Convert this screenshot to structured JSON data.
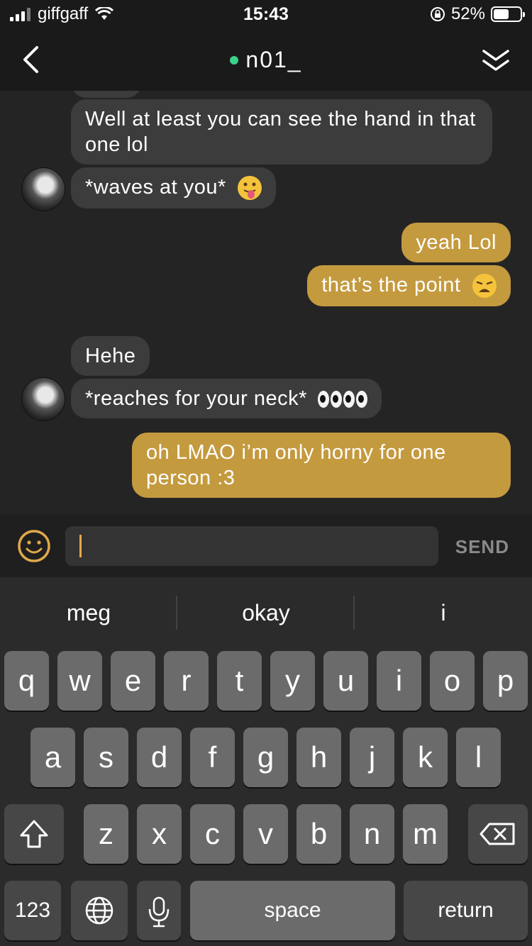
{
  "status": {
    "carrier": "giffgaff",
    "time": "15:43",
    "battery": "52%"
  },
  "header": {
    "contact_name": "n01_"
  },
  "messages": [
    {
      "dir": "in",
      "text": "Well at least you can see the hand in that one lol"
    },
    {
      "dir": "in",
      "text": "*waves at you*",
      "emoji": "tongue-out-emoji"
    },
    {
      "dir": "out",
      "text": "yeah Lol"
    },
    {
      "dir": "out",
      "text": "that’s the point",
      "emoji": "weary-face-emoji"
    },
    {
      "dir": "in",
      "text": "Hehe"
    },
    {
      "dir": "in",
      "text": "*reaches for your neck*",
      "emoji": "eyes-emoji"
    },
    {
      "dir": "out",
      "text": "oh LMAO i’m only horny  for one person :3"
    }
  ],
  "input": {
    "value": "",
    "send_label": "SEND"
  },
  "keyboard": {
    "suggestions": [
      "meg",
      "okay",
      "i"
    ],
    "row1": [
      "q",
      "w",
      "e",
      "r",
      "t",
      "y",
      "u",
      "i",
      "o",
      "p"
    ],
    "row2": [
      "a",
      "s",
      "d",
      "f",
      "g",
      "h",
      "j",
      "k",
      "l"
    ],
    "row3": [
      "z",
      "x",
      "c",
      "v",
      "b",
      "n",
      "m"
    ],
    "numbers_label": "123",
    "space_label": "space",
    "return_label": "return"
  },
  "colors": {
    "outgoing": "#c49a3f",
    "incoming": "#3c3c3c",
    "online": "#3ad28a",
    "accent": "#e0a94a"
  }
}
